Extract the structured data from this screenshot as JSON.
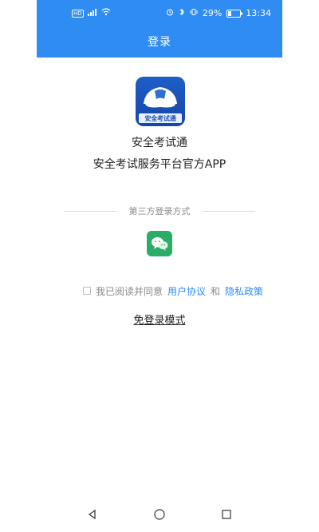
{
  "status_bar": {
    "hd_badge": "HD",
    "battery_percent": "29%",
    "time": "13:34"
  },
  "header": {
    "title": "登录"
  },
  "app": {
    "logo_text": "安全考试通",
    "name": "安全考试通",
    "description": "安全考试服务平台官方APP"
  },
  "third_party": {
    "label": "第三方登录方式",
    "wechat_icon": "wechat-icon"
  },
  "agreement": {
    "prefix": "我已阅读并同意",
    "user_agreement": "用户协议",
    "and": "和",
    "privacy_policy": "隐私政策"
  },
  "free_login": {
    "label": "免登录模式"
  },
  "nav_icons": {
    "back": "back-triangle-icon",
    "home": "home-circle-icon",
    "recent": "recent-square-icon"
  },
  "colors": {
    "primary": "#2f8cf2",
    "wechat": "#2aae67",
    "muted_text": "#8a8a8a",
    "divider": "#d9d9d9",
    "link": "#2f8cf2"
  }
}
